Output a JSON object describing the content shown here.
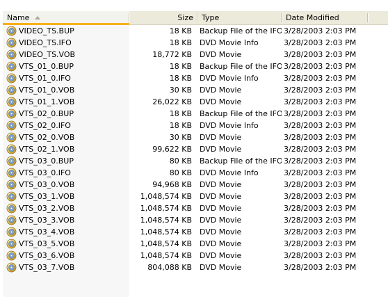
{
  "columns": {
    "name": "Name",
    "size": "Size",
    "type": "Type",
    "date": "Date Modified"
  },
  "sort": {
    "column": "name",
    "direction": "ascending"
  },
  "colors": {
    "header_bg": "#ebeadb",
    "sorted_header_accent": "#f9b119",
    "sorted_column_bg": "#f7f7f7"
  },
  "file_icon": "dvd-disc-icon",
  "files": [
    {
      "name": "VIDEO_TS.BUP",
      "size": "18 KB",
      "type": "Backup File of the IFO",
      "date": "3/28/2003 2:03 PM"
    },
    {
      "name": "VIDEO_TS.IFO",
      "size": "18 KB",
      "type": "DVD Movie Info",
      "date": "3/28/2003 2:03 PM"
    },
    {
      "name": "VIDEO_TS.VOB",
      "size": "18,772 KB",
      "type": "DVD Movie",
      "date": "3/28/2003 2:03 PM"
    },
    {
      "name": "VTS_01_0.BUP",
      "size": "18 KB",
      "type": "Backup File of the IFO",
      "date": "3/28/2003 2:03 PM"
    },
    {
      "name": "VTS_01_0.IFO",
      "size": "18 KB",
      "type": "DVD Movie Info",
      "date": "3/28/2003 2:03 PM"
    },
    {
      "name": "VTS_01_0.VOB",
      "size": "30 KB",
      "type": "DVD Movie",
      "date": "3/28/2003 2:03 PM"
    },
    {
      "name": "VTS_01_1.VOB",
      "size": "26,022 KB",
      "type": "DVD Movie",
      "date": "3/28/2003 2:03 PM"
    },
    {
      "name": "VTS_02_0.BUP",
      "size": "18 KB",
      "type": "Backup File of the IFO",
      "date": "3/28/2003 2:03 PM"
    },
    {
      "name": "VTS_02_0.IFO",
      "size": "18 KB",
      "type": "DVD Movie Info",
      "date": "3/28/2003 2:03 PM"
    },
    {
      "name": "VTS_02_0.VOB",
      "size": "30 KB",
      "type": "DVD Movie",
      "date": "3/28/2003 2:03 PM"
    },
    {
      "name": "VTS_02_1.VOB",
      "size": "99,622 KB",
      "type": "DVD Movie",
      "date": "3/28/2003 2:03 PM"
    },
    {
      "name": "VTS_03_0.BUP",
      "size": "80 KB",
      "type": "Backup File of the IFO",
      "date": "3/28/2003 2:03 PM"
    },
    {
      "name": "VTS_03_0.IFO",
      "size": "80 KB",
      "type": "DVD Movie Info",
      "date": "3/28/2003 2:03 PM"
    },
    {
      "name": "VTS_03_0.VOB",
      "size": "94,968 KB",
      "type": "DVD Movie",
      "date": "3/28/2003 2:03 PM"
    },
    {
      "name": "VTS_03_1.VOB",
      "size": "1,048,574 KB",
      "type": "DVD Movie",
      "date": "3/28/2003 2:03 PM"
    },
    {
      "name": "VTS_03_2.VOB",
      "size": "1,048,574 KB",
      "type": "DVD Movie",
      "date": "3/28/2003 2:03 PM"
    },
    {
      "name": "VTS_03_3.VOB",
      "size": "1,048,574 KB",
      "type": "DVD Movie",
      "date": "3/28/2003 2:03 PM"
    },
    {
      "name": "VTS_03_4.VOB",
      "size": "1,048,574 KB",
      "type": "DVD Movie",
      "date": "3/28/2003 2:03 PM"
    },
    {
      "name": "VTS_03_5.VOB",
      "size": "1,048,574 KB",
      "type": "DVD Movie",
      "date": "3/28/2003 2:03 PM"
    },
    {
      "name": "VTS_03_6.VOB",
      "size": "1,048,574 KB",
      "type": "DVD Movie",
      "date": "3/28/2003 2:03 PM"
    },
    {
      "name": "VTS_03_7.VOB",
      "size": "804,088 KB",
      "type": "DVD Movie",
      "date": "3/28/2003 2:03 PM"
    }
  ]
}
